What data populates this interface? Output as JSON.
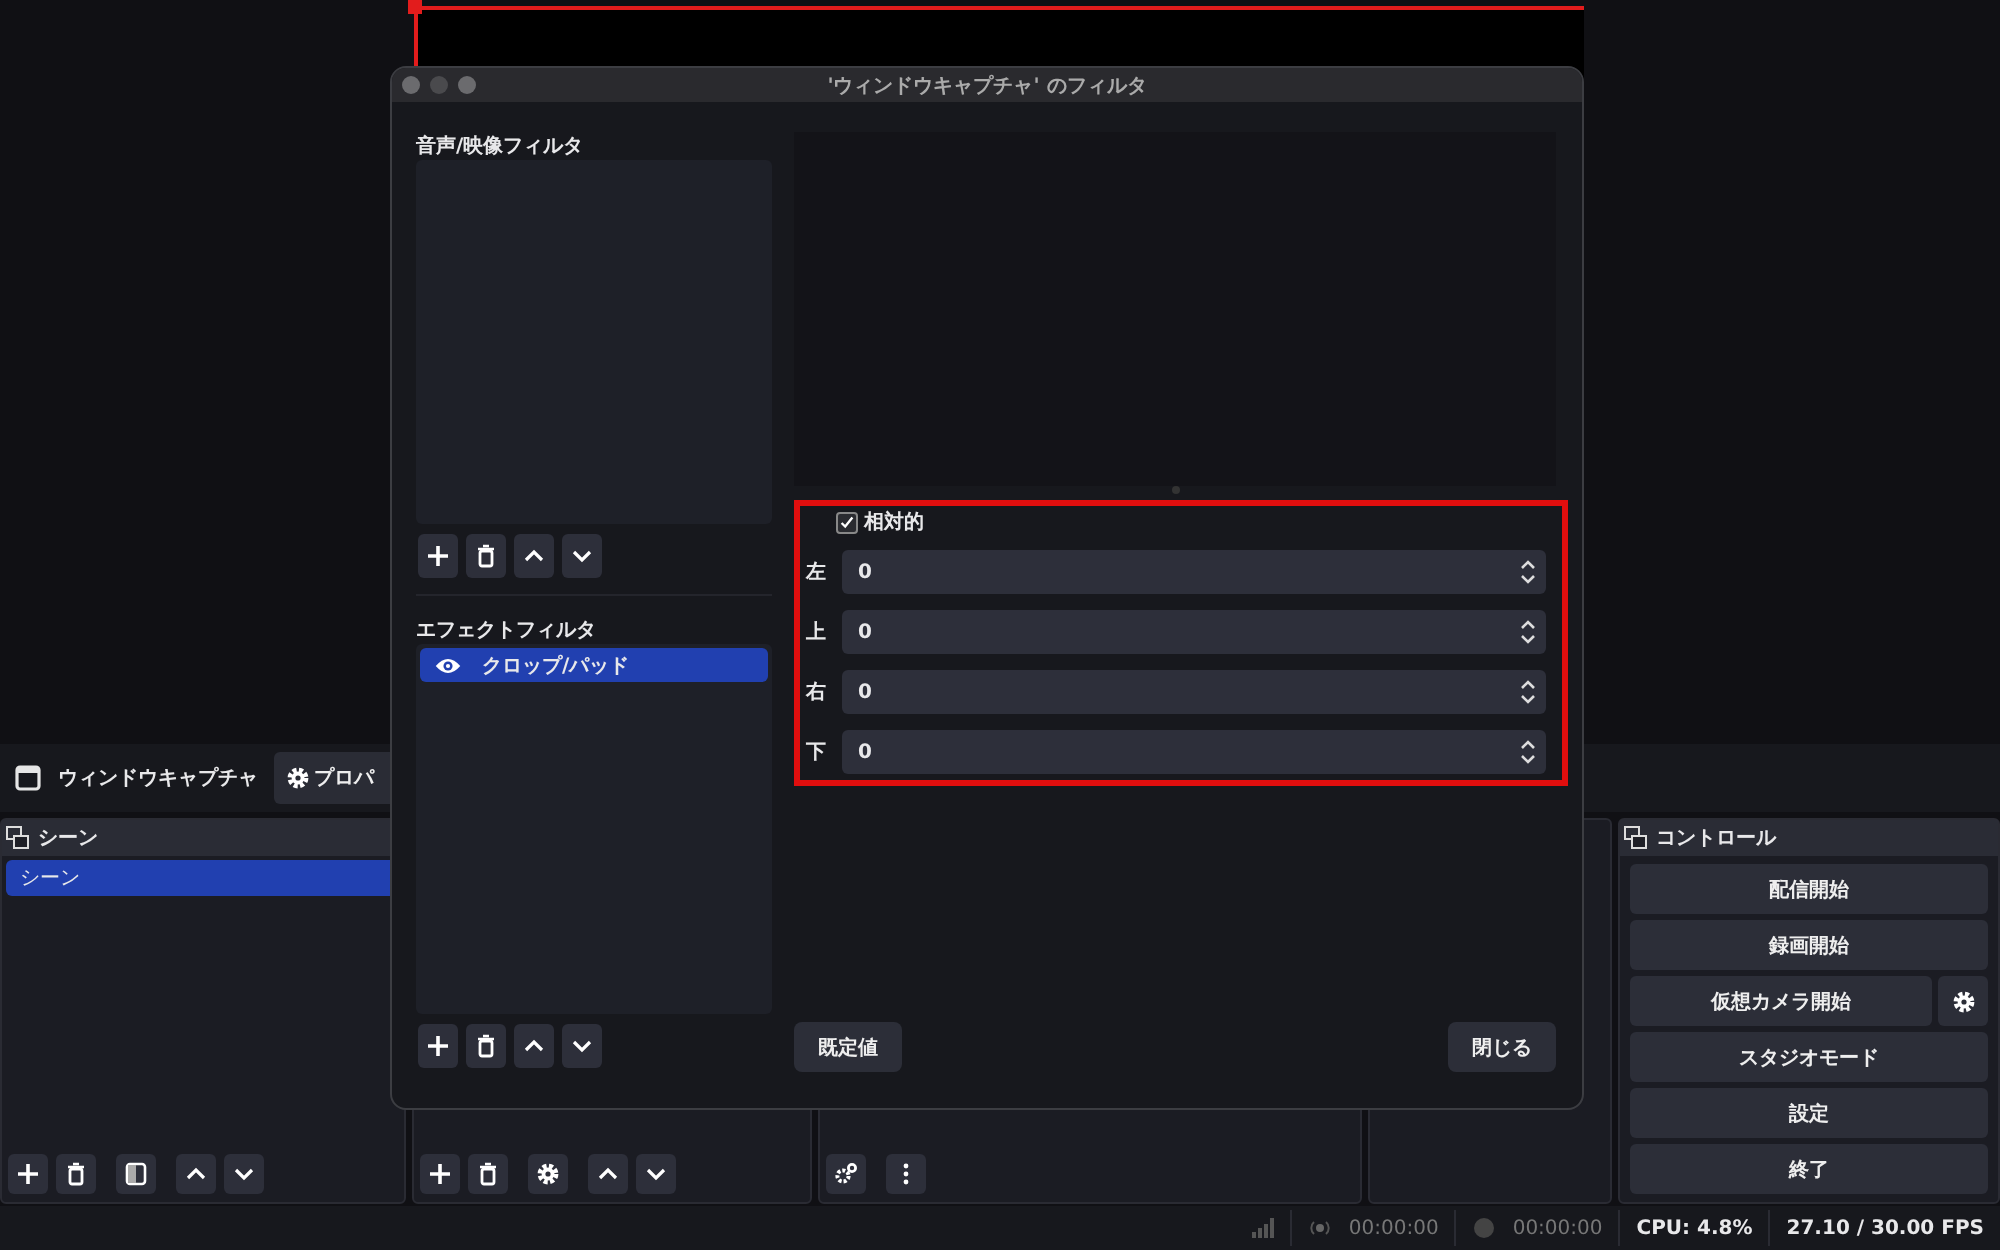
{
  "source_toolbar": {
    "source_name": "ウィンドウキャプチャ",
    "properties_button": "プロパ"
  },
  "scenes_dock": {
    "title": "シーン",
    "items": [
      {
        "label": "シーン",
        "selected": true
      }
    ]
  },
  "controls_dock": {
    "title": "コントロール",
    "buttons": [
      {
        "label": "配信開始",
        "kind": "plain"
      },
      {
        "label": "録画開始",
        "kind": "plain"
      },
      {
        "label": "仮想カメラ開始",
        "kind": "with_settings"
      },
      {
        "label": "スタジオモード",
        "kind": "plain"
      },
      {
        "label": "設定",
        "kind": "plain"
      },
      {
        "label": "終了",
        "kind": "plain"
      }
    ]
  },
  "status_bar": {
    "stream_time": "00:00:00",
    "record_time": "00:00:00",
    "cpu": "CPU: 4.8%",
    "fps": "27.10 / 30.00 FPS"
  },
  "dialog": {
    "title": "'ウィンドウキャプチャ' のフィルタ",
    "audio_video_filters": {
      "label": "音声/映像フィルタ"
    },
    "effect_filters": {
      "label": "エフェクトフィルタ",
      "items": [
        {
          "label": "クロップ/パッド",
          "selected": true
        }
      ]
    },
    "properties": {
      "relative": {
        "label": "相対的",
        "checked": true
      },
      "fields": [
        {
          "label": "左",
          "value": "0"
        },
        {
          "label": "上",
          "value": "0"
        },
        {
          "label": "右",
          "value": "0"
        },
        {
          "label": "下",
          "value": "0"
        }
      ]
    },
    "buttons": {
      "defaults": "既定値",
      "close": "閉じる"
    }
  }
}
